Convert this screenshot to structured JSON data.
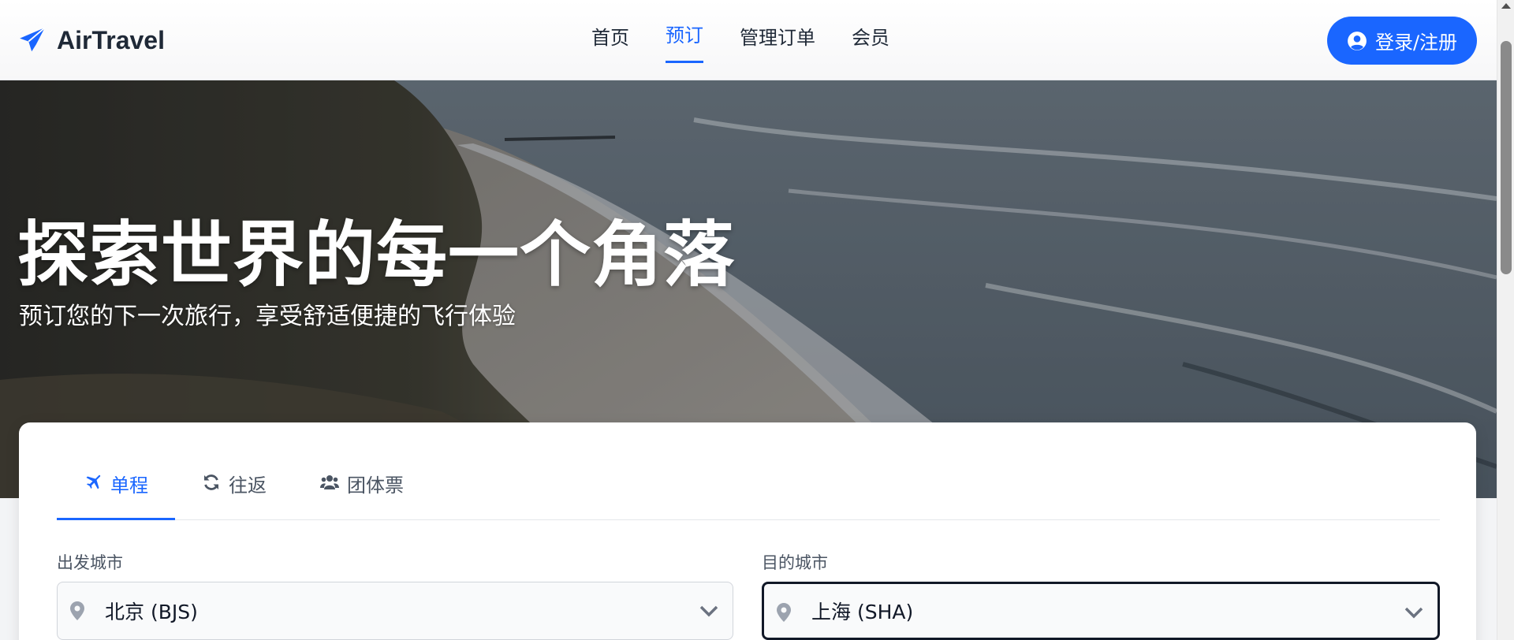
{
  "header": {
    "brand": "AirTravel",
    "nav": [
      {
        "label": "首页",
        "active": false
      },
      {
        "label": "预订",
        "active": true
      },
      {
        "label": "管理订单",
        "active": false
      },
      {
        "label": "会员",
        "active": false
      }
    ],
    "login_label": "登录/注册"
  },
  "hero": {
    "title": "探索世界的每一个角落",
    "subtitle": "预订您的下一次旅行，享受舒适便捷的飞行体验"
  },
  "booking": {
    "tabs": [
      {
        "label": "单程",
        "icon": "plane-icon",
        "active": true
      },
      {
        "label": "往返",
        "icon": "sync-icon",
        "active": false
      },
      {
        "label": "团体票",
        "icon": "users-icon",
        "active": false
      }
    ],
    "from": {
      "label": "出发城市",
      "value": "北京 (BJS)"
    },
    "to": {
      "label": "目的城市",
      "value": "上海 (SHA)"
    }
  },
  "colors": {
    "accent": "#1a66ff",
    "text": "#1f2937"
  }
}
